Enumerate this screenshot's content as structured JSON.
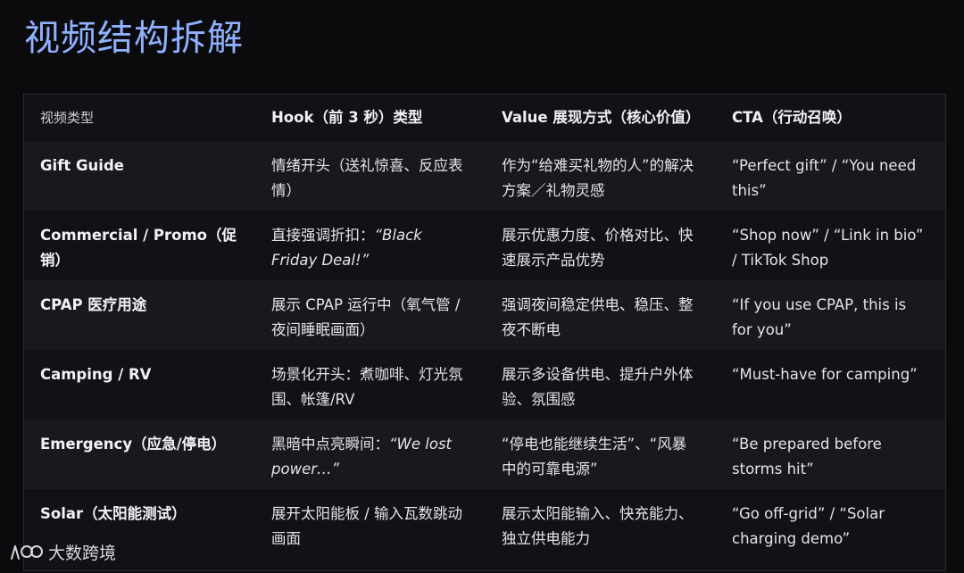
{
  "title": "视频结构拆解",
  "table": {
    "headers": [
      "视频类型",
      "Hook（前 3 秒）类型",
      "Value 展现方式（核心价值）",
      "CTA（行动召唤）"
    ],
    "rows": [
      {
        "type": "Gift Guide",
        "hook": "情绪开头（送礼惊喜、反应表情）",
        "hook_quote": "",
        "value": "作为“给难买礼物的人”的解决方案／礼物灵感",
        "cta": "“Perfect gift”  /  “You need this”"
      },
      {
        "type": "Commercial / Promo（促销）",
        "hook": "直接强调折扣：",
        "hook_quote": "“Black Friday Deal!”",
        "value": "展示优惠力度、价格对比、快速展示产品优势",
        "cta": "“Shop now”  /  “Link in bio”  / TikTok Shop"
      },
      {
        "type": "CPAP 医疗用途",
        "hook": "展示 CPAP 运行中（氧气管 / 夜间睡眠画面）",
        "hook_quote": "",
        "value": "强调夜间稳定供电、稳压、整夜不断电",
        "cta": "“If you use CPAP, this is for you”"
      },
      {
        "type": "Camping / RV",
        "hook": "场景化开头：煮咖啡、灯光氛围、帐篷/RV",
        "hook_quote": "",
        "value": "展示多设备供电、提升户外体验、氛围感",
        "cta": "“Must-have for camping”"
      },
      {
        "type": "Emergency（应急/停电）",
        "hook": "黑暗中点亮瞬间：",
        "hook_quote": "“We lost power…”",
        "value": "“停电也能继续生活”、“风暴中的可靠电源”",
        "cta": "“Be prepared before storms hit”"
      },
      {
        "type": "Solar（太阳能测试）",
        "hook": "展开太阳能板 / 输入瓦数跳动画面",
        "hook_quote": "",
        "value": "展示太阳能输入、快充能力、独立供电能力",
        "cta": "“Go off-grid”  /  “Solar charging demo”"
      }
    ]
  },
  "watermark": {
    "text": "大数跨境",
    "icon": "brand-logo-icon"
  }
}
